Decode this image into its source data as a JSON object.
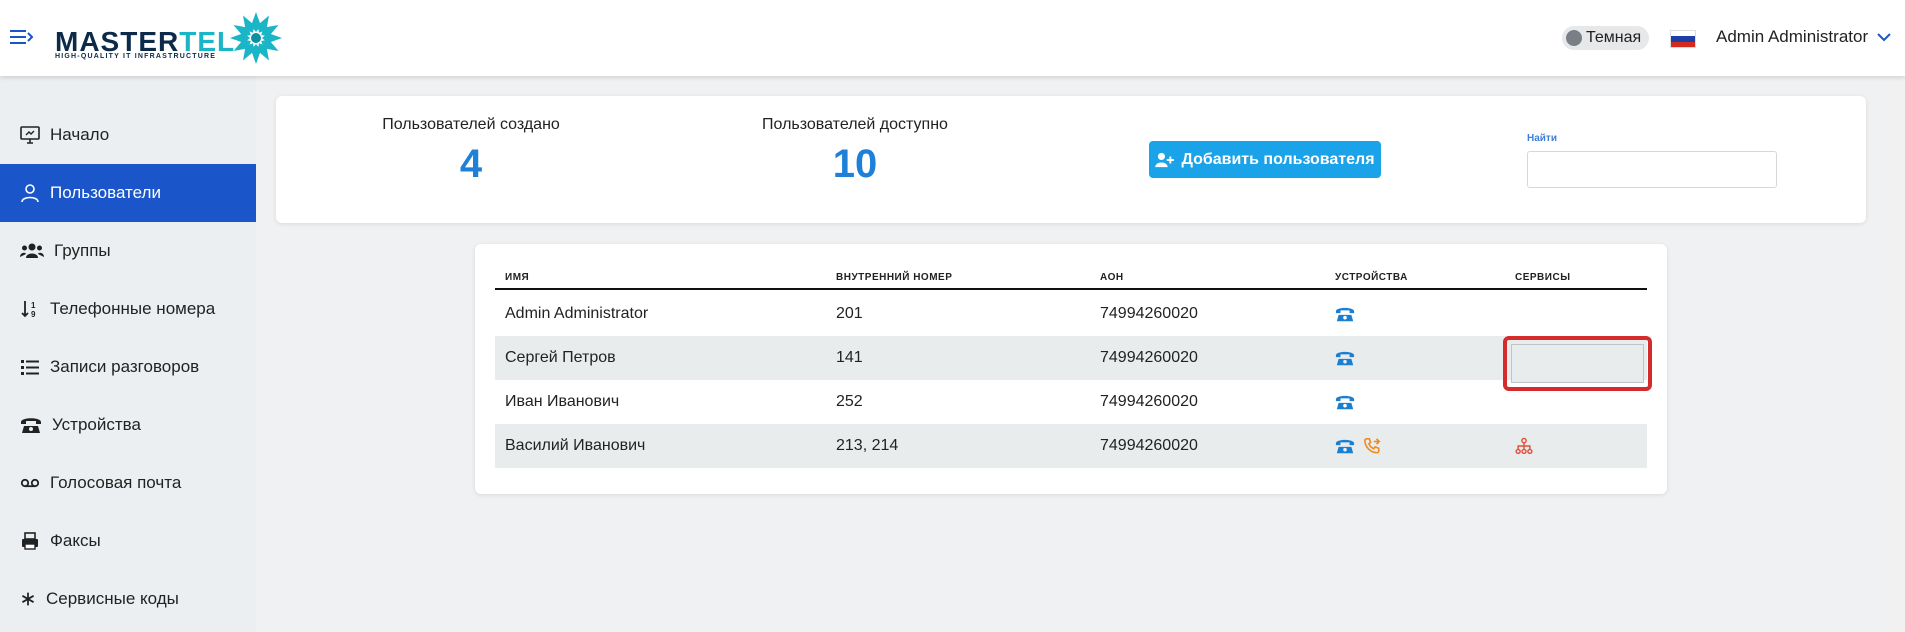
{
  "header": {
    "logo": {
      "text_dark": "MASTER",
      "text_teal": "TEL",
      "tagline": "HIGH-QUALITY IT INFRASTRUCTURE"
    },
    "theme_label": "Темная",
    "user_name": "Admin Administrator"
  },
  "sidebar": {
    "items": [
      {
        "label": "Начало",
        "icon": "monitor-icon"
      },
      {
        "label": "Пользователи",
        "icon": "user-icon"
      },
      {
        "label": "Группы",
        "icon": "users-group-icon"
      },
      {
        "label": "Телефонные номера",
        "icon": "sort-numbers-icon"
      },
      {
        "label": "Записи разговоров",
        "icon": "list-icon"
      },
      {
        "label": "Устройства",
        "icon": "phone-icon"
      },
      {
        "label": "Голосовая почта",
        "icon": "voicemail-icon"
      },
      {
        "label": "Факсы",
        "icon": "fax-icon"
      },
      {
        "label": "Сервисные коды",
        "icon": "asterisk-icon"
      }
    ]
  },
  "summary": {
    "created_label": "Пользователей создано",
    "created_value": "4",
    "available_label": "Пользователей доступно",
    "available_value": "10",
    "add_button_label": "Добавить пользователя",
    "search_label": "Найти",
    "search_value": ""
  },
  "table": {
    "headers": [
      "ИМЯ",
      "ВНУТРЕННИЙ НОМЕР",
      "АОН",
      "УСТРОЙСТВА",
      "СЕРВИСЫ"
    ],
    "rows": [
      {
        "name": "Admin Administrator",
        "ext": "201",
        "aon": "74994260020",
        "devices": [
          "desk-phone-icon"
        ],
        "services": []
      },
      {
        "name": "Сергей Петров",
        "ext": "141",
        "aon": "74994260020",
        "devices": [
          "desk-phone-icon"
        ],
        "services": []
      },
      {
        "name": "Иван Иванович",
        "ext": "252",
        "aon": "74994260020",
        "devices": [
          "desk-phone-icon"
        ],
        "services": []
      },
      {
        "name": "Василий Иванович",
        "ext": "213, 214",
        "aon": "74994260020",
        "devices": [
          "desk-phone-icon",
          "call-forward-icon"
        ],
        "services": [
          "hierarchy-icon"
        ]
      }
    ]
  },
  "colors": {
    "accent": "#1a56c9",
    "stat_value": "#1f80d8",
    "button": "#1aa3e8",
    "highlight": "#d42b2b",
    "forward_icon": "#f08a1c",
    "service_icon": "#e0503a"
  }
}
